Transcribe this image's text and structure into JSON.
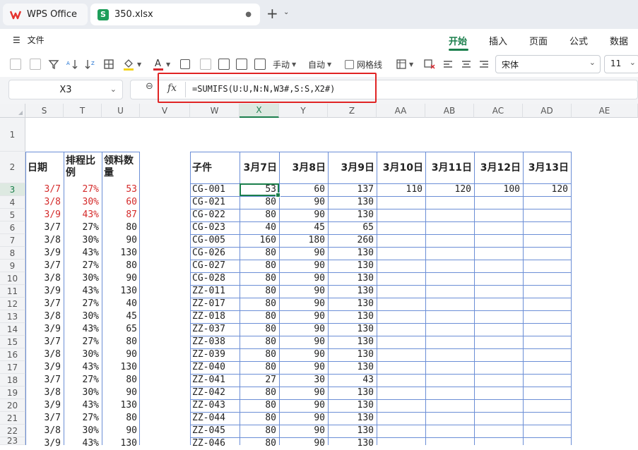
{
  "tabs": {
    "app": "WPS Office",
    "file": "350.xlsx"
  },
  "menu": {
    "file": "文件",
    "items": [
      "开始",
      "插入",
      "页面",
      "公式",
      "数据"
    ]
  },
  "toolbar": {
    "manual": "手动",
    "auto": "自动",
    "gridlines": "网格线",
    "font": "宋体",
    "size": "11"
  },
  "formula_bar": {
    "cell_ref": "X3",
    "fx": "fx",
    "formula": "=SUMIFS(U:U,N:N,W3#,S:S,X2#)"
  },
  "columns": [
    "S",
    "T",
    "U",
    "V",
    "W",
    "X",
    "Y",
    "Z",
    "AA",
    "AB",
    "AC",
    "AD",
    "AE"
  ],
  "rows": [
    "1",
    "2",
    "3",
    "4",
    "5",
    "6",
    "7",
    "8",
    "9",
    "10",
    "11",
    "12",
    "13",
    "14",
    "15",
    "16",
    "17",
    "18",
    "19",
    "20",
    "21",
    "22",
    "23"
  ],
  "left_table": {
    "headers": [
      "日期",
      "排程比例",
      "领料数量"
    ],
    "rows": [
      [
        "3/7",
        "27%",
        "53"
      ],
      [
        "3/8",
        "30%",
        "60"
      ],
      [
        "3/9",
        "43%",
        "87"
      ],
      [
        "3/7",
        "27%",
        "80"
      ],
      [
        "3/8",
        "30%",
        "90"
      ],
      [
        "3/9",
        "43%",
        "130"
      ],
      [
        "3/7",
        "27%",
        "80"
      ],
      [
        "3/8",
        "30%",
        "90"
      ],
      [
        "3/9",
        "43%",
        "130"
      ],
      [
        "3/7",
        "27%",
        "40"
      ],
      [
        "3/8",
        "30%",
        "45"
      ],
      [
        "3/9",
        "43%",
        "65"
      ],
      [
        "3/7",
        "27%",
        "80"
      ],
      [
        "3/8",
        "30%",
        "90"
      ],
      [
        "3/9",
        "43%",
        "130"
      ],
      [
        "3/7",
        "27%",
        "80"
      ],
      [
        "3/8",
        "30%",
        "90"
      ],
      [
        "3/9",
        "43%",
        "130"
      ],
      [
        "3/7",
        "27%",
        "80"
      ],
      [
        "3/8",
        "30%",
        "90"
      ],
      [
        "3/9",
        "43%",
        "130"
      ]
    ]
  },
  "right_table": {
    "headers": [
      "子件",
      "3月7日",
      "3月8日",
      "3月9日",
      "3月10日",
      "3月11日",
      "3月12日",
      "3月13日"
    ],
    "rows": [
      [
        "CG-001",
        "53",
        "60",
        "137",
        "110",
        "120",
        "100",
        "120"
      ],
      [
        "CG-021",
        "80",
        "90",
        "130",
        "",
        "",
        "",
        ""
      ],
      [
        "CG-022",
        "80",
        "90",
        "130",
        "",
        "",
        "",
        ""
      ],
      [
        "CG-023",
        "40",
        "45",
        "65",
        "",
        "",
        "",
        ""
      ],
      [
        "CG-005",
        "160",
        "180",
        "260",
        "",
        "",
        "",
        ""
      ],
      [
        "CG-026",
        "80",
        "90",
        "130",
        "",
        "",
        "",
        ""
      ],
      [
        "CG-027",
        "80",
        "90",
        "130",
        "",
        "",
        "",
        ""
      ],
      [
        "CG-028",
        "80",
        "90",
        "130",
        "",
        "",
        "",
        ""
      ],
      [
        "ZZ-011",
        "80",
        "90",
        "130",
        "",
        "",
        "",
        ""
      ],
      [
        "ZZ-017",
        "80",
        "90",
        "130",
        "",
        "",
        "",
        ""
      ],
      [
        "ZZ-018",
        "80",
        "90",
        "130",
        "",
        "",
        "",
        ""
      ],
      [
        "ZZ-037",
        "80",
        "90",
        "130",
        "",
        "",
        "",
        ""
      ],
      [
        "ZZ-038",
        "80",
        "90",
        "130",
        "",
        "",
        "",
        ""
      ],
      [
        "ZZ-039",
        "80",
        "90",
        "130",
        "",
        "",
        "",
        ""
      ],
      [
        "ZZ-040",
        "80",
        "90",
        "130",
        "",
        "",
        "",
        ""
      ],
      [
        "ZZ-041",
        "27",
        "30",
        "43",
        "",
        "",
        "",
        ""
      ],
      [
        "ZZ-042",
        "80",
        "90",
        "130",
        "",
        "",
        "",
        ""
      ],
      [
        "ZZ-043",
        "80",
        "90",
        "130",
        "",
        "",
        "",
        ""
      ],
      [
        "ZZ-044",
        "80",
        "90",
        "130",
        "",
        "",
        "",
        ""
      ],
      [
        "ZZ-045",
        "80",
        "90",
        "130",
        "",
        "",
        "",
        ""
      ],
      [
        "ZZ-046",
        "80",
        "90",
        "130",
        "",
        "",
        "",
        ""
      ]
    ]
  },
  "colors": {
    "accent": "#1b7f4c",
    "red_text": "#d42a2a",
    "table_border": "#6b8ed6",
    "highlight_box": "#e02424"
  }
}
